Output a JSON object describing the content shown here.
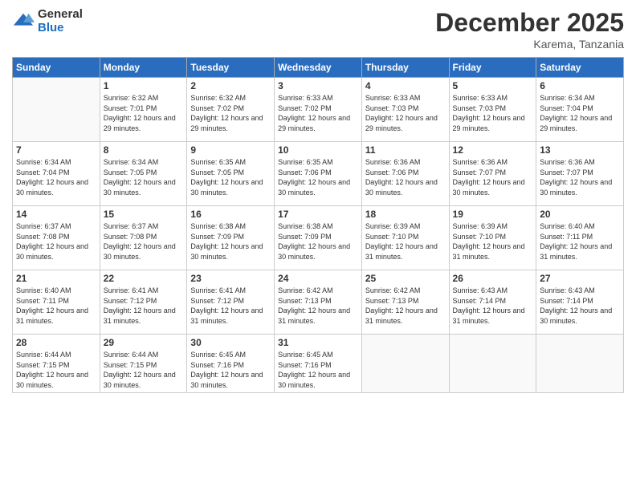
{
  "logo": {
    "general": "General",
    "blue": "Blue"
  },
  "header": {
    "month": "December 2025",
    "location": "Karema, Tanzania"
  },
  "weekdays": [
    "Sunday",
    "Monday",
    "Tuesday",
    "Wednesday",
    "Thursday",
    "Friday",
    "Saturday"
  ],
  "days": [
    {
      "num": "",
      "empty": true
    },
    {
      "num": "1",
      "rise": "6:32 AM",
      "set": "7:01 PM",
      "daylight": "12 hours and 29 minutes."
    },
    {
      "num": "2",
      "rise": "6:32 AM",
      "set": "7:02 PM",
      "daylight": "12 hours and 29 minutes."
    },
    {
      "num": "3",
      "rise": "6:33 AM",
      "set": "7:02 PM",
      "daylight": "12 hours and 29 minutes."
    },
    {
      "num": "4",
      "rise": "6:33 AM",
      "set": "7:03 PM",
      "daylight": "12 hours and 29 minutes."
    },
    {
      "num": "5",
      "rise": "6:33 AM",
      "set": "7:03 PM",
      "daylight": "12 hours and 29 minutes."
    },
    {
      "num": "6",
      "rise": "6:34 AM",
      "set": "7:04 PM",
      "daylight": "12 hours and 29 minutes."
    },
    {
      "num": "7",
      "rise": "6:34 AM",
      "set": "7:04 PM",
      "daylight": "12 hours and 30 minutes."
    },
    {
      "num": "8",
      "rise": "6:34 AM",
      "set": "7:05 PM",
      "daylight": "12 hours and 30 minutes."
    },
    {
      "num": "9",
      "rise": "6:35 AM",
      "set": "7:05 PM",
      "daylight": "12 hours and 30 minutes."
    },
    {
      "num": "10",
      "rise": "6:35 AM",
      "set": "7:06 PM",
      "daylight": "12 hours and 30 minutes."
    },
    {
      "num": "11",
      "rise": "6:36 AM",
      "set": "7:06 PM",
      "daylight": "12 hours and 30 minutes."
    },
    {
      "num": "12",
      "rise": "6:36 AM",
      "set": "7:07 PM",
      "daylight": "12 hours and 30 minutes."
    },
    {
      "num": "13",
      "rise": "6:36 AM",
      "set": "7:07 PM",
      "daylight": "12 hours and 30 minutes."
    },
    {
      "num": "14",
      "rise": "6:37 AM",
      "set": "7:08 PM",
      "daylight": "12 hours and 30 minutes."
    },
    {
      "num": "15",
      "rise": "6:37 AM",
      "set": "7:08 PM",
      "daylight": "12 hours and 30 minutes."
    },
    {
      "num": "16",
      "rise": "6:38 AM",
      "set": "7:09 PM",
      "daylight": "12 hours and 30 minutes."
    },
    {
      "num": "17",
      "rise": "6:38 AM",
      "set": "7:09 PM",
      "daylight": "12 hours and 30 minutes."
    },
    {
      "num": "18",
      "rise": "6:39 AM",
      "set": "7:10 PM",
      "daylight": "12 hours and 31 minutes."
    },
    {
      "num": "19",
      "rise": "6:39 AM",
      "set": "7:10 PM",
      "daylight": "12 hours and 31 minutes."
    },
    {
      "num": "20",
      "rise": "6:40 AM",
      "set": "7:11 PM",
      "daylight": "12 hours and 31 minutes."
    },
    {
      "num": "21",
      "rise": "6:40 AM",
      "set": "7:11 PM",
      "daylight": "12 hours and 31 minutes."
    },
    {
      "num": "22",
      "rise": "6:41 AM",
      "set": "7:12 PM",
      "daylight": "12 hours and 31 minutes."
    },
    {
      "num": "23",
      "rise": "6:41 AM",
      "set": "7:12 PM",
      "daylight": "12 hours and 31 minutes."
    },
    {
      "num": "24",
      "rise": "6:42 AM",
      "set": "7:13 PM",
      "daylight": "12 hours and 31 minutes."
    },
    {
      "num": "25",
      "rise": "6:42 AM",
      "set": "7:13 PM",
      "daylight": "12 hours and 31 minutes."
    },
    {
      "num": "26",
      "rise": "6:43 AM",
      "set": "7:14 PM",
      "daylight": "12 hours and 31 minutes."
    },
    {
      "num": "27",
      "rise": "6:43 AM",
      "set": "7:14 PM",
      "daylight": "12 hours and 30 minutes."
    },
    {
      "num": "28",
      "rise": "6:44 AM",
      "set": "7:15 PM",
      "daylight": "12 hours and 30 minutes."
    },
    {
      "num": "29",
      "rise": "6:44 AM",
      "set": "7:15 PM",
      "daylight": "12 hours and 30 minutes."
    },
    {
      "num": "30",
      "rise": "6:45 AM",
      "set": "7:16 PM",
      "daylight": "12 hours and 30 minutes."
    },
    {
      "num": "31",
      "rise": "6:45 AM",
      "set": "7:16 PM",
      "daylight": "12 hours and 30 minutes."
    },
    {
      "num": "",
      "empty": true
    },
    {
      "num": "",
      "empty": true
    },
    {
      "num": "",
      "empty": true
    }
  ],
  "labels": {
    "sunrise": "Sunrise:",
    "sunset": "Sunset:",
    "daylight": "Daylight:"
  }
}
